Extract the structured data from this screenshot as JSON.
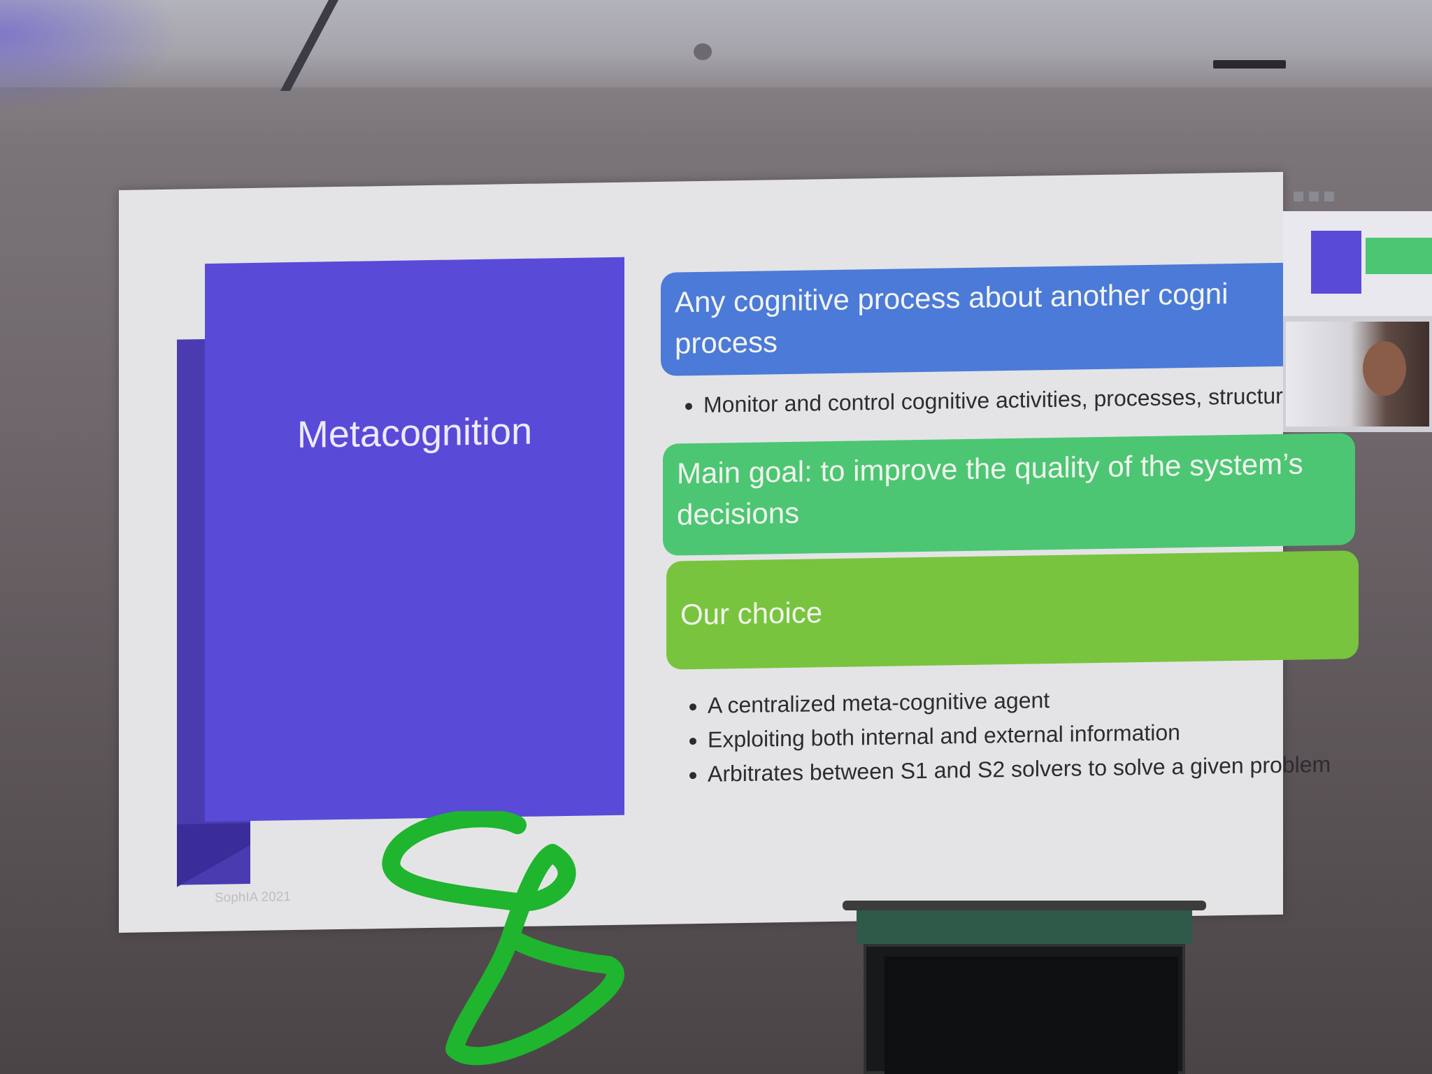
{
  "slide": {
    "title": "Metacognition",
    "box_definition": "Any cognitive process about another cogni process",
    "definition_bullets": [
      "Monitor and control cognitive activities, processes, structures"
    ],
    "box_goal": "Main goal: to improve the quality of the system’s decisions",
    "box_choice": "Our choice",
    "choice_bullets": [
      "A centralized meta-cognitive agent",
      "Exploiting both internal and external information",
      "Arbitrates between S1 and S2 solvers to solve a given problem"
    ],
    "footer": "SophIA 2021"
  },
  "colors": {
    "title_panel": "#5a4ad8",
    "definition_box": "#4b7ad8",
    "goal_box": "#4cc673",
    "choice_box": "#78c43e",
    "annotation_stroke": "#1fb52e"
  },
  "annotation": {
    "type": "handwritten-scribble",
    "depicts": "digit 8"
  }
}
